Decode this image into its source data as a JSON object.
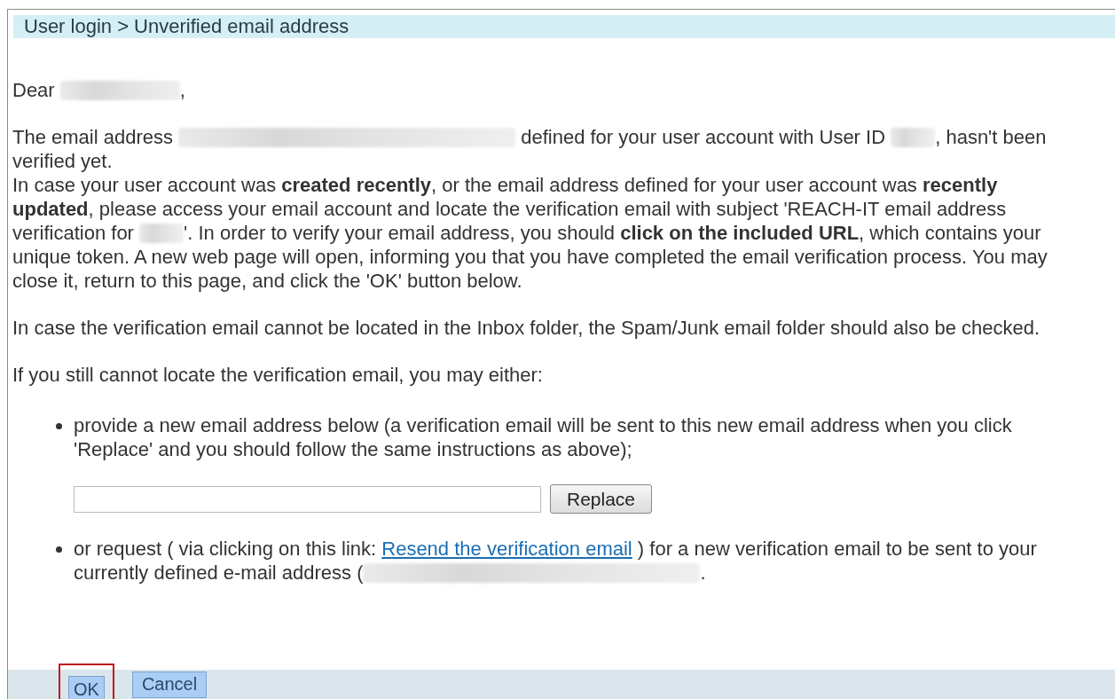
{
  "breadcrumb": "User login > Unverified email address",
  "sections": [
    [
      [
        {
          "kind": "text",
          "text": "Dear "
        },
        {
          "kind": "redacted_medium"
        },
        {
          "kind": "text",
          "text": ","
        }
      ]
    ],
    [
      [
        {
          "kind": "text",
          "text": "The email address "
        },
        {
          "kind": "redacted_long"
        },
        {
          "kind": "text",
          "text": " defined for your user account with User ID "
        },
        {
          "kind": "redacted_short"
        },
        {
          "kind": "text",
          "text": ", hasn't been"
        }
      ],
      [
        {
          "kind": "text",
          "text": "verified yet."
        }
      ],
      [
        {
          "kind": "text",
          "text": "In case your user account was **created recently**, or the email address defined for your user account was **recently**"
        }
      ],
      [
        {
          "kind": "text",
          "text": "**updated**, please access your email account and locate the verification email with subject 'REACH-IT email address"
        }
      ],
      [
        {
          "kind": "text",
          "text": "verification for "
        },
        {
          "kind": "redacted_short"
        },
        {
          "kind": "text",
          "text": "'. In order to verify your email address, you should **click on the included URL**, which contains your"
        }
      ],
      [
        {
          "kind": "text",
          "text": "unique token. A new web page will open, informing you that you have completed the email verification process. You may"
        }
      ],
      [
        {
          "kind": "text",
          "text": "close it, return to this page, and click the 'OK' button below."
        }
      ]
    ],
    [
      [
        {
          "kind": "text",
          "text": "In case the verification email cannot be located in the Inbox folder, the Spam/Junk email folder should also be checked."
        }
      ]
    ],
    [
      [
        {
          "kind": "text",
          "text": "If you still cannot locate the verification email, you may either:"
        }
      ]
    ]
  ],
  "options": [
    {
      "lines": [
        [
          {
            "kind": "text",
            "text": "provide a new email address below (a verification email will be sent to this new email address when you click"
          }
        ],
        [
          {
            "kind": "text",
            "text": "'Replace' and you should follow the same instructions as above);"
          }
        ]
      ],
      "form": {
        "button": "Replace"
      }
    },
    {
      "lines": [
        [
          {
            "kind": "text",
            "text": "or request ( via clicking on this link: "
          },
          {
            "kind": "link",
            "text": "Resend the verification email"
          },
          {
            "kind": "text",
            "text": " ) for a new verification email to be sent to your"
          }
        ],
        [
          {
            "kind": "text",
            "text": "currently defined e-mail address ("
          },
          {
            "kind": "redacted_long"
          },
          {
            "kind": "text",
            "text": "."
          }
        ]
      ]
    }
  ],
  "buttons": [
    {
      "label": "OK",
      "highlighted": true
    },
    {
      "label": "Cancel",
      "highlighted": false
    }
  ]
}
